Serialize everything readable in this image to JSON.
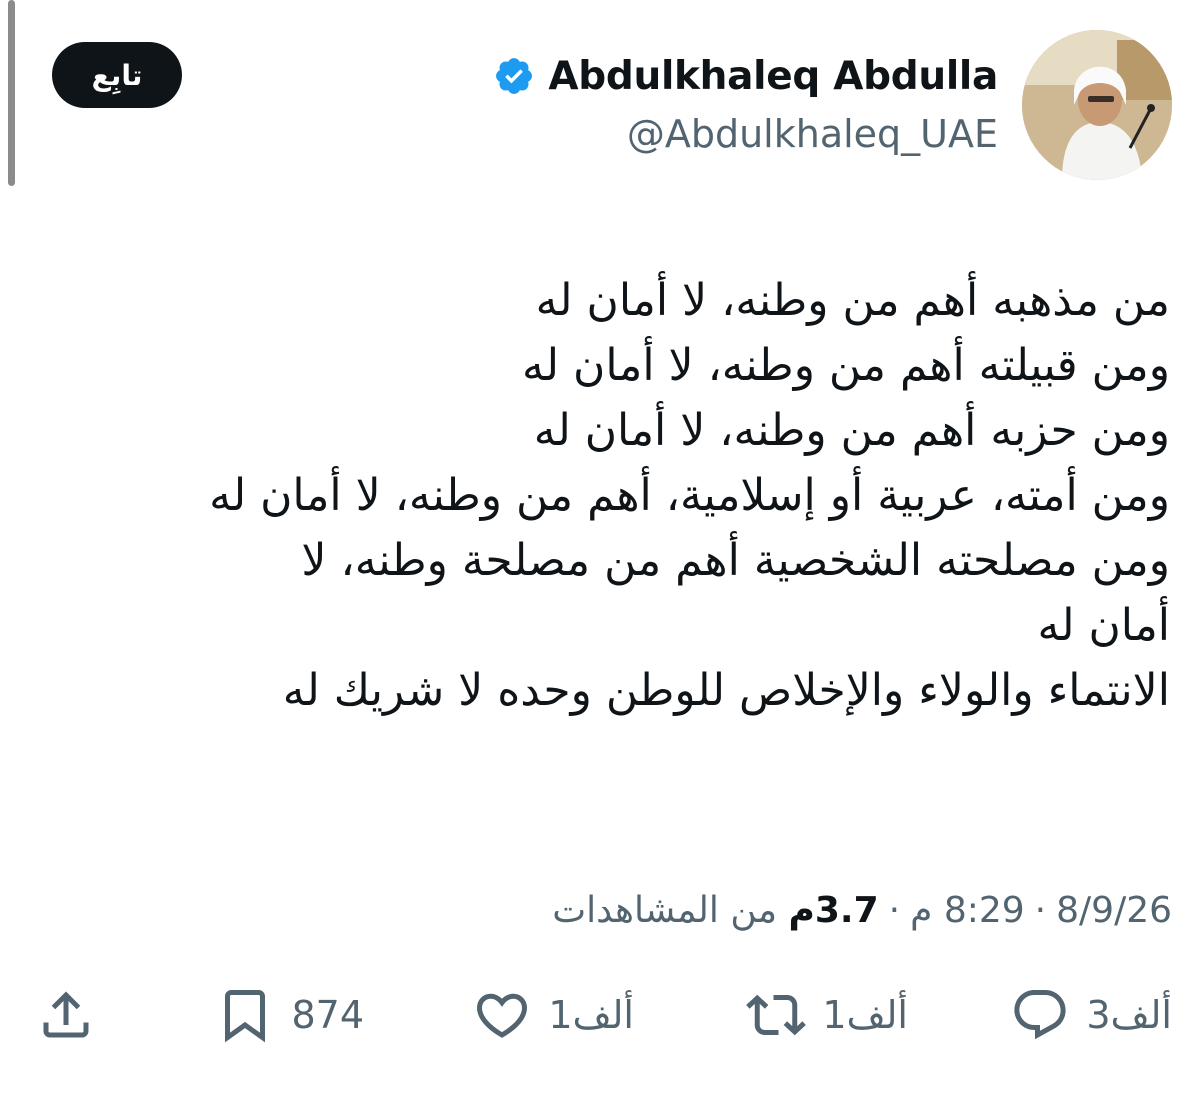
{
  "header": {
    "follow_label": "تابِع",
    "display_name": "Abdulkhaleq Abdulla",
    "handle": "@Abdulkhaleq_UAE",
    "verified_color": "#1d9bf0"
  },
  "tweet": {
    "text": "من مذهبه أهم من وطنه، لا أمان له\nومن قبيلته أهم من وطنه، لا أمان له\nومن حزبه أهم من وطنه، لا أمان له\nومن أمته، عربية أو إسلامية، أهم من وطنه، لا أمان له\nومن مصلحته الشخصية أهم من مصلحة وطنه، لا\nأمان له\nالانتماء والولاء والإخلاص للوطن وحده لا شريك له"
  },
  "meta": {
    "date": "8/9/26",
    "separator": "·",
    "time": "8:29 م",
    "views_count": "3.7م",
    "views_label": "من المشاهدات"
  },
  "actions": {
    "replies": {
      "count": "3ألف",
      "icon": "reply-icon"
    },
    "reposts": {
      "count": "1ألف",
      "icon": "repost-icon"
    },
    "likes": {
      "count": "1ألف",
      "icon": "heart-icon"
    },
    "bookmarks": {
      "count": "874",
      "icon": "bookmark-icon"
    },
    "share": {
      "icon": "share-icon"
    }
  }
}
